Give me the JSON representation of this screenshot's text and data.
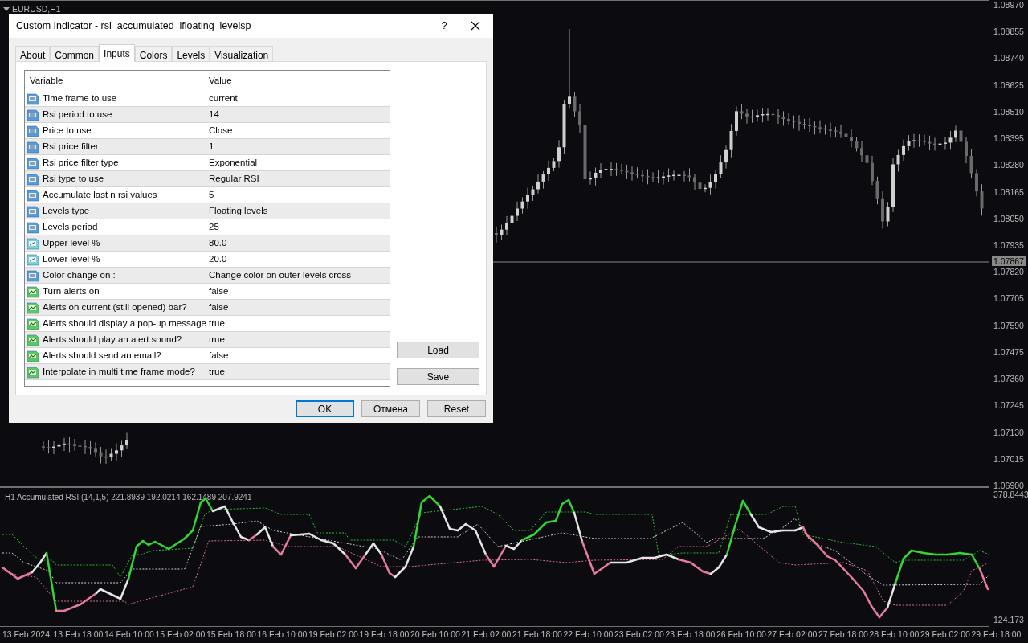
{
  "chart": {
    "symbol": "EURUSD,H1",
    "price_labels": [
      "1.08970",
      "1.08855",
      "1.08740",
      "1.08625",
      "1.08510",
      "1.08395",
      "1.08280",
      "1.08165",
      "1.08050",
      "1.07935",
      "1.07820",
      "1.07705",
      "1.07590",
      "1.07475",
      "1.07360",
      "1.07245",
      "1.07130",
      "1.07015",
      "1.06900"
    ],
    "current_price": "1.07867"
  },
  "indicator": {
    "title": "H1 Accumulated RSI (14,1,5) 221.8939 192.0214 162.1489 207.9241",
    "axis_max": "378.8443",
    "axis_min": "124.173"
  },
  "time_labels": [
    "13 Feb 2024",
    "13 Feb 18:00",
    "14 Feb 10:00",
    "15 Feb 02:00",
    "15 Feb 18:00",
    "16 Feb 10:00",
    "19 Feb 02:00",
    "19 Feb 18:00",
    "20 Feb 10:00",
    "21 Feb 02:00",
    "21 Feb 18:00",
    "22 Feb 10:00",
    "23 Feb 02:00",
    "23 Feb 18:00",
    "26 Feb 10:00",
    "27 Feb 02:00",
    "27 Feb 18:00",
    "28 Feb 10:00",
    "29 Feb 02:00",
    "29 Feb 18:00"
  ],
  "dialog": {
    "title": "Custom Indicator - rsi_accumulated_ifloating_levelsp",
    "help": "?",
    "tabs": [
      {
        "label": "About",
        "selected": false
      },
      {
        "label": "Common",
        "selected": false
      },
      {
        "label": "Inputs",
        "selected": true
      },
      {
        "label": "Colors",
        "selected": false
      },
      {
        "label": "Levels",
        "selected": false
      },
      {
        "label": "Visualization",
        "selected": false
      }
    ],
    "columns": [
      "Variable",
      "Value"
    ],
    "rows": [
      {
        "kind": "int",
        "name": "Time frame to use",
        "value": "current"
      },
      {
        "kind": "int",
        "name": "Rsi period to use",
        "value": "14"
      },
      {
        "kind": "int",
        "name": "Price to use",
        "value": "Close"
      },
      {
        "kind": "int",
        "name": "Rsi price filter",
        "value": "1"
      },
      {
        "kind": "int",
        "name": "Rsi price filter type",
        "value": "Exponential"
      },
      {
        "kind": "int",
        "name": "Rsi type to use",
        "value": "Regular RSI"
      },
      {
        "kind": "int",
        "name": "Accumulate last n rsi values",
        "value": "5"
      },
      {
        "kind": "int",
        "name": "Levels type",
        "value": "Floating levels"
      },
      {
        "kind": "int",
        "name": "Levels period",
        "value": "25"
      },
      {
        "kind": "double",
        "name": "Upper level %",
        "value": "80.0"
      },
      {
        "kind": "double",
        "name": "Lower level %",
        "value": "20.0"
      },
      {
        "kind": "int",
        "name": "Color change on :",
        "value": "Change color on outer levels cross"
      },
      {
        "kind": "bool",
        "name": "Turn alerts on",
        "value": "false"
      },
      {
        "kind": "bool",
        "name": "Alerts on current (still opened) bar?",
        "value": "false"
      },
      {
        "kind": "bool",
        "name": "Alerts should display a pop-up message",
        "value": "true"
      },
      {
        "kind": "bool",
        "name": "Alerts should play an alert sound?",
        "value": "true"
      },
      {
        "kind": "bool",
        "name": "Alerts should send an email?",
        "value": "false"
      },
      {
        "kind": "bool",
        "name": "Interpolate in multi time frame mode?",
        "value": "true"
      }
    ],
    "side_buttons": [
      "Load",
      "Save"
    ],
    "buttons": [
      {
        "label": "OK",
        "default": true
      },
      {
        "label": "Отмена",
        "default": false
      },
      {
        "label": "Reset",
        "default": false
      }
    ]
  }
}
